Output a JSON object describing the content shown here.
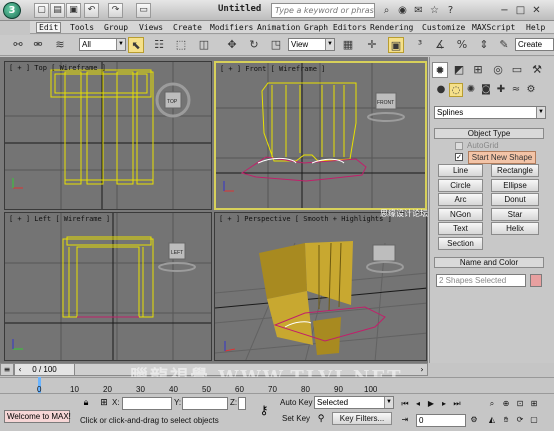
{
  "titlebar": {
    "logo": "3",
    "doc_title": "Untitled",
    "search_placeholder": "Type a keyword or phrase"
  },
  "menu": [
    "Edit",
    "Tools",
    "Group",
    "Views",
    "Create",
    "Modifiers",
    "Animation",
    "Graph Editors",
    "Rendering",
    "Customize",
    "MAXScript",
    "Help"
  ],
  "toolbar": {
    "selection_filter": "All",
    "ref_coord": "View",
    "named_selection": "Create"
  },
  "viewports": {
    "top": {
      "label": "[ + ] Top [ Wireframe ]",
      "cube": "TOP"
    },
    "front": {
      "label": "[ + ] Front [ Wireframe ]",
      "cube": "FRONT"
    },
    "left": {
      "label": "[ + ] Left [ Wireframe ]",
      "cube": "LEFT"
    },
    "perspective": {
      "label": "[ + ] Perspective [ Smooth + Highlights ]"
    }
  },
  "command_panel": {
    "category_dropdown": "Splines",
    "object_type_header": "Object Type",
    "autogrid_label": "AutoGrid",
    "start_new_shape": "Start New Shape",
    "buttons": [
      "Line",
      "Rectangle",
      "Circle",
      "Ellipse",
      "Arc",
      "Donut",
      "NGon",
      "Star",
      "Text",
      "Helix",
      "Section"
    ],
    "name_color_header": "Name and Color",
    "name_value": "2 Shapes Selected",
    "swatch_color": "#e8a0a0"
  },
  "timeline": {
    "frame_readout": "0 / 100",
    "ticks": [
      "0",
      "10",
      "20",
      "30",
      "40",
      "50",
      "60",
      "70",
      "80",
      "90",
      "100"
    ]
  },
  "status": {
    "maxscript_listener": "Welcome to MAX!",
    "x_label": "X:",
    "y_label": "Y:",
    "z_label": "Z:",
    "prompt": "Click or click-and-drag to select objects",
    "auto_key": "Auto Key",
    "set_key": "Set Key",
    "key_mode": "Selected",
    "key_filters": "Key Filters...",
    "current_frame": "0"
  },
  "watermark": "臘龍視覺 WWW.TLVI.NET",
  "watermark2": "思缘设计论坛 www.MISSYUAN.COM",
  "colors": {
    "active_border": "#d7d05a",
    "spline_yellow": "#e8e000",
    "spline_magenta": "#c0206a",
    "viewport_bg": "#747474",
    "mesh_fill": "#c8a830"
  }
}
